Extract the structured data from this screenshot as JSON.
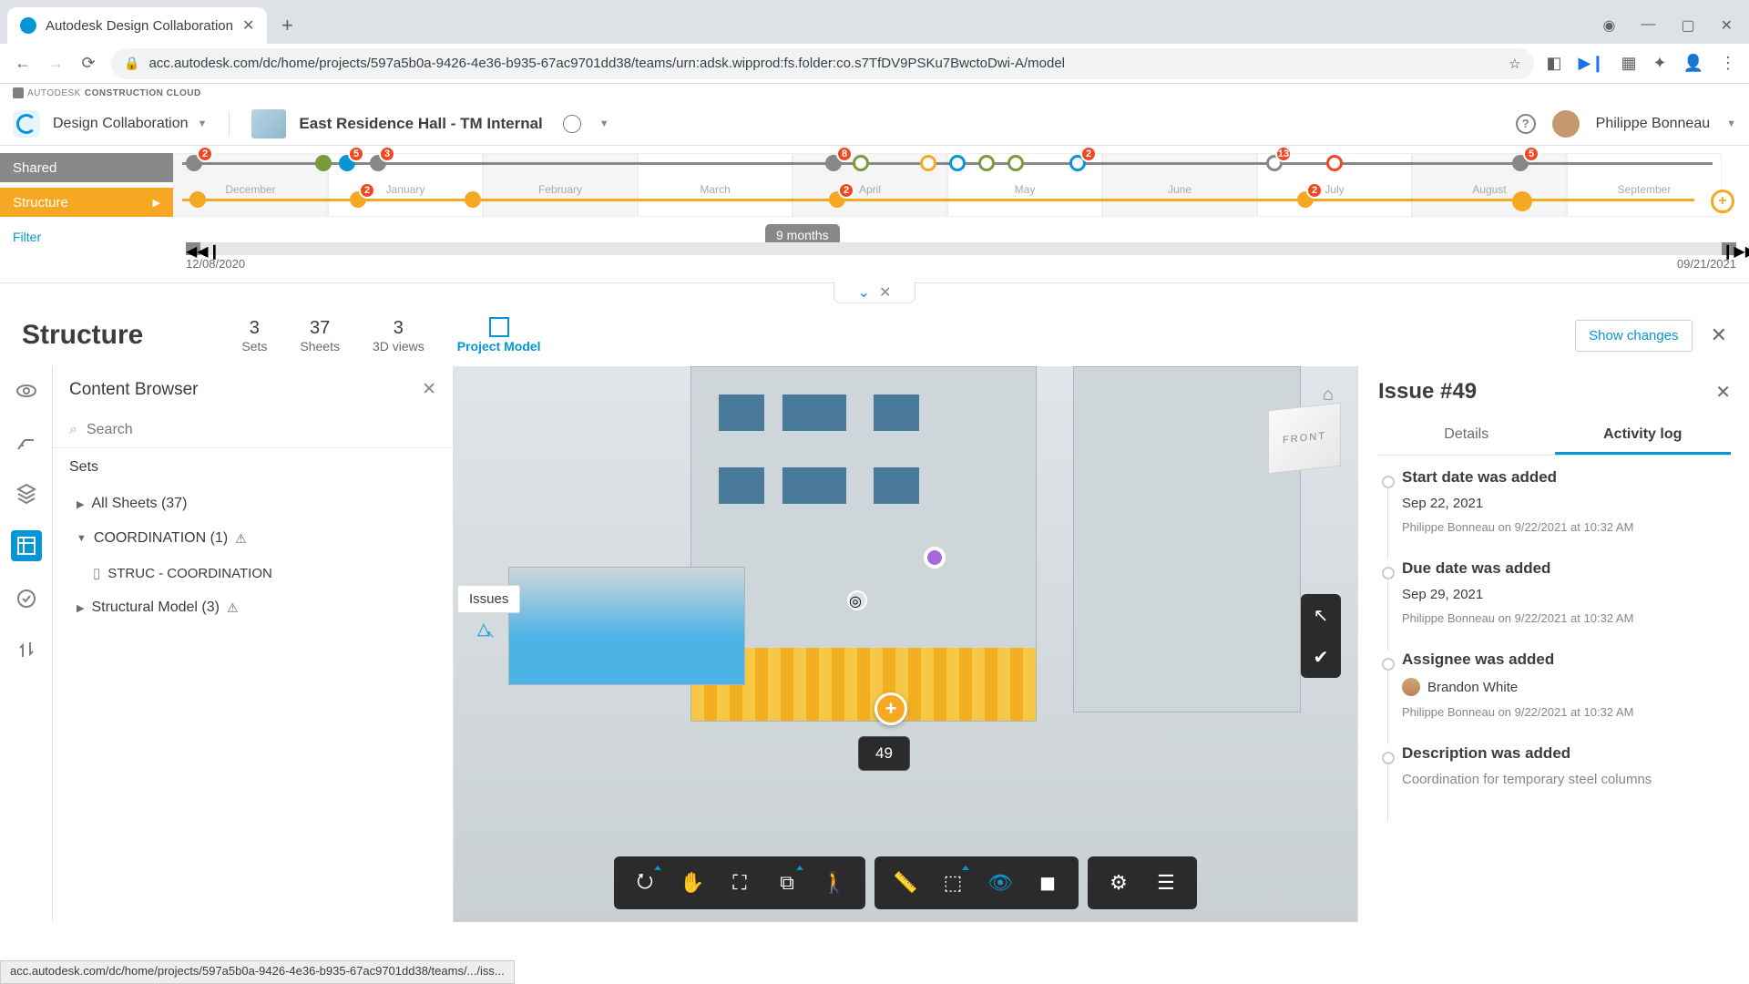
{
  "browser": {
    "tab_title": "Autodesk Design Collaboration",
    "url": "acc.autodesk.com/dc/home/projects/597a5b0a-9426-4e36-b935-67ac9701dd38/teams/urn:adsk.wipprod:fs.folder:co.s7TfDV9PSKu7BwctoDwi-A/model",
    "status_url": "acc.autodesk.com/dc/home/projects/597a5b0a-9426-4e36-b935-67ac9701dd38/teams/.../iss..."
  },
  "brand": {
    "pre": "AUTODESK",
    "name": "CONSTRUCTION CLOUD"
  },
  "header": {
    "module": "Design Collaboration",
    "project": "East Residence Hall - TM Internal",
    "user": "Philippe Bonneau"
  },
  "timeline": {
    "lanes": {
      "shared": "Shared",
      "structure": "Structure"
    },
    "filter": "Filter",
    "months": [
      "December",
      "January",
      "February",
      "March",
      "April",
      "May",
      "June",
      "July",
      "August",
      "September"
    ],
    "range": "9 months",
    "start": "12/08/2020",
    "end": "09/21/2021",
    "badges": {
      "dec_s": "2",
      "jan_s1": "5",
      "jan_s2": "3",
      "apr_s": "8",
      "may_s": "2",
      "aug_s": "13",
      "sep_s": "5",
      "jan_t": "2",
      "apr_t": "2",
      "aug_t": "2"
    }
  },
  "section": {
    "title": "Structure",
    "stats": {
      "sets_n": "3",
      "sets_l": "Sets",
      "sheets_n": "37",
      "sheets_l": "Sheets",
      "views_n": "3",
      "views_l": "3D views",
      "model": "Project Model"
    },
    "show_changes": "Show changes"
  },
  "browser_panel": {
    "title": "Content Browser",
    "search_ph": "Search",
    "sets_lbl": "Sets",
    "row1": "All Sheets (37)",
    "row2": "COORDINATION (1)",
    "row3": "STRUC - COORDINATION",
    "row4": "Structural Model (3)"
  },
  "viewer": {
    "tooltip": "Issues",
    "cube": "FRONT",
    "issue_label": "49"
  },
  "issue_panel": {
    "title": "Issue #49",
    "tabs": {
      "details": "Details",
      "activity": "Activity log"
    },
    "log": [
      {
        "title": "Start date was added",
        "value": "Sep 22, 2021",
        "meta": "Philippe Bonneau on 9/22/2021 at 10:32 AM"
      },
      {
        "title": "Due date was added",
        "value": "Sep 29, 2021",
        "meta": "Philippe Bonneau on 9/22/2021 at 10:32 AM"
      },
      {
        "title": "Assignee was added",
        "value": "Brandon White",
        "meta": "Philippe Bonneau on 9/22/2021 at 10:32 AM",
        "avatar": true
      },
      {
        "title": "Description was added",
        "value": "Coordination for temporary steel columns",
        "meta": ""
      }
    ]
  }
}
